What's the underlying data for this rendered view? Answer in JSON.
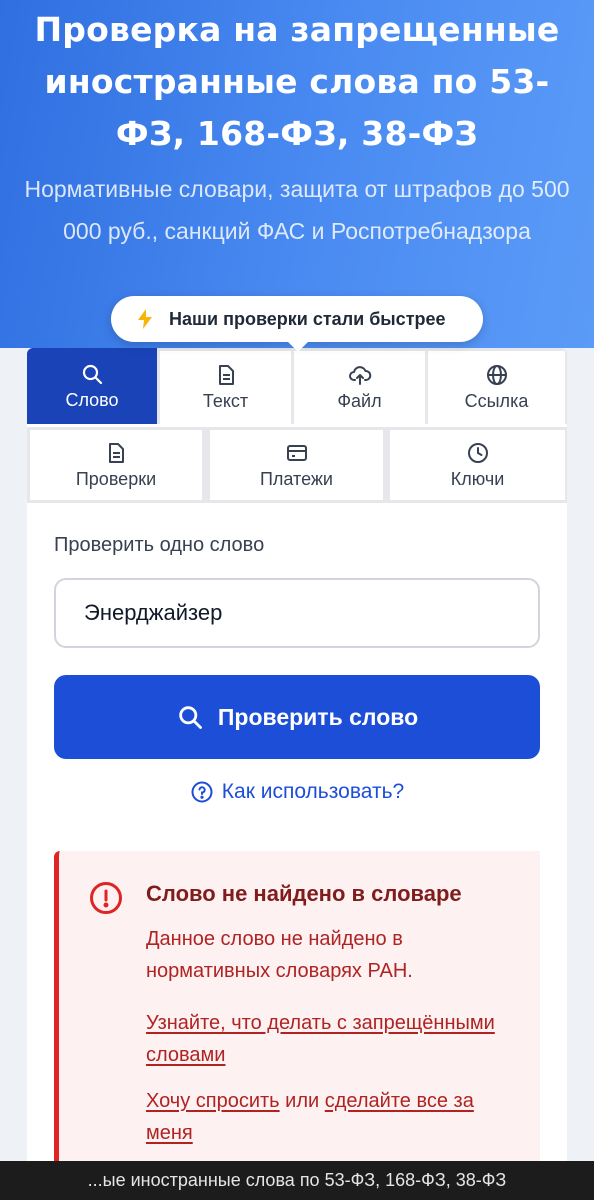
{
  "hero": {
    "title": "Проверка на запрещенные иностранные слова по 53-ФЗ, 168-ФЗ, 38-ФЗ",
    "subtitle": "Нормативные словари, защита от штрафов до 500 000 руб., санкций ФАС и Роспотребнадзора",
    "pill_text": "Наши проверки стали быстрее"
  },
  "tabs_row1": [
    {
      "label": "Слово",
      "icon": "search-icon",
      "active": true
    },
    {
      "label": "Текст",
      "icon": "document-icon",
      "active": false
    },
    {
      "label": "Файл",
      "icon": "upload-cloud-icon",
      "active": false
    },
    {
      "label": "Ссылка",
      "icon": "globe-icon",
      "active": false
    }
  ],
  "tabs_row2": [
    {
      "label": "Проверки",
      "icon": "document-icon"
    },
    {
      "label": "Платежи",
      "icon": "credit-card-icon"
    },
    {
      "label": "Ключи",
      "icon": "clock-icon"
    }
  ],
  "form": {
    "label": "Проверить одно слово",
    "input_value": "Энерджайзер",
    "button_label": "Проверить слово",
    "help_link": "Как использовать?"
  },
  "result": {
    "title": "Слово не найдено в словаре",
    "description": "Данное слово не найдено в нормативных словарях РАН.",
    "link_what_to_do": "Узнайте, что делать с запрещёнными словами",
    "link_ask": "Хочу спросить",
    "or_text": "или",
    "link_do_all": "сделайте все за меня"
  },
  "bottom_bar": {
    "text": "...ые иностранные слова по 53-ФЗ, 168-ФЗ, 38-ФЗ"
  },
  "colors": {
    "primary": "#1d4ed8",
    "active_tab": "#1a43b8",
    "error": "#e02424",
    "error_bg": "#fdf1f1"
  }
}
